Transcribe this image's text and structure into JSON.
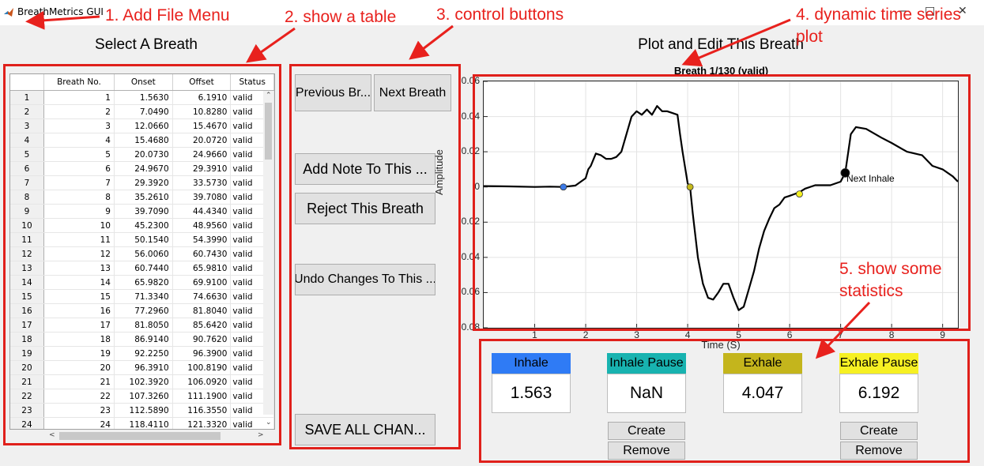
{
  "window": {
    "title": "BreathMetrics GUI",
    "minimize": "—",
    "maximize": "□",
    "close": "✕"
  },
  "annotations": {
    "a1": "1. Add File Menu",
    "a2": "2. show a table",
    "a3": "3. control buttons",
    "a4_line1": "4. dynamic time series",
    "a4_line2": "plot",
    "a5_line1": "5. show some",
    "a5_line2": "statistics"
  },
  "left_panel": {
    "title": "Select A Breath"
  },
  "table": {
    "columns": [
      "Breath No.",
      "Onset",
      "Offset",
      "Status"
    ],
    "rows": [
      [
        "1",
        "1",
        "1.5630",
        "6.1910",
        "valid"
      ],
      [
        "2",
        "2",
        "7.0490",
        "10.8280",
        "valid"
      ],
      [
        "3",
        "3",
        "12.0660",
        "15.4670",
        "valid"
      ],
      [
        "4",
        "4",
        "15.4680",
        "20.0720",
        "valid"
      ],
      [
        "5",
        "5",
        "20.0730",
        "24.9660",
        "valid"
      ],
      [
        "6",
        "6",
        "24.9670",
        "29.3910",
        "valid"
      ],
      [
        "7",
        "7",
        "29.3920",
        "33.5730",
        "valid"
      ],
      [
        "8",
        "8",
        "35.2610",
        "39.7080",
        "valid"
      ],
      [
        "9",
        "9",
        "39.7090",
        "44.4340",
        "valid"
      ],
      [
        "10",
        "10",
        "45.2300",
        "48.9560",
        "valid"
      ],
      [
        "11",
        "11",
        "50.1540",
        "54.3990",
        "valid"
      ],
      [
        "12",
        "12",
        "56.0060",
        "60.7430",
        "valid"
      ],
      [
        "13",
        "13",
        "60.7440",
        "65.9810",
        "valid"
      ],
      [
        "14",
        "14",
        "65.9820",
        "69.9100",
        "valid"
      ],
      [
        "15",
        "15",
        "71.3340",
        "74.6630",
        "valid"
      ],
      [
        "16",
        "16",
        "77.2960",
        "81.8040",
        "valid"
      ],
      [
        "17",
        "17",
        "81.8050",
        "85.6420",
        "valid"
      ],
      [
        "18",
        "18",
        "86.9140",
        "90.7620",
        "valid"
      ],
      [
        "19",
        "19",
        "92.2250",
        "96.3900",
        "valid"
      ],
      [
        "20",
        "20",
        "96.3910",
        "100.8190",
        "valid"
      ],
      [
        "21",
        "21",
        "102.3920",
        "106.0920",
        "valid"
      ],
      [
        "22",
        "22",
        "107.3260",
        "111.1900",
        "valid"
      ],
      [
        "23",
        "23",
        "112.5890",
        "116.3550",
        "valid"
      ],
      [
        "24",
        "24",
        "118.4110",
        "121.3320",
        "valid"
      ]
    ]
  },
  "controls": {
    "prev": "Previous Br...",
    "next": "Next Breath",
    "add_note": "Add Note To This ...",
    "reject": "Reject This Breath",
    "undo": "Undo Changes To This ...",
    "save": "SAVE ALL CHAN..."
  },
  "plot_panel": {
    "title": "Plot and Edit This Breath"
  },
  "plot": {
    "title": "Breath 1/130 (valid)",
    "xlabel": "Time (S)",
    "ylabel": "Amplitude",
    "next_inhale_label": "Next Inhale",
    "x_ticks": [
      "1",
      "2",
      "3",
      "4",
      "5",
      "6",
      "7",
      "8",
      "9"
    ],
    "y_ticks": [
      "0.06",
      "0.04",
      "0.02",
      "0",
      "-0.02",
      "-0.04",
      "-0.06",
      "-0.08"
    ]
  },
  "chart_data": {
    "type": "line",
    "title": "Breath 1/130 (valid)",
    "xlabel": "Time (S)",
    "ylabel": "Amplitude",
    "xlim": [
      0.0,
      9.3
    ],
    "ylim": [
      -0.08,
      0.06
    ],
    "grid": true,
    "series": [
      {
        "x": [
          0.0,
          0.5,
          1.0,
          1.3,
          1.563,
          1.8,
          2.0,
          2.05,
          2.1,
          2.2,
          2.3,
          2.4,
          2.5,
          2.6,
          2.7,
          2.8,
          2.9,
          3.0,
          3.1,
          3.2,
          3.3,
          3.4,
          3.5,
          3.6,
          3.7,
          3.8,
          3.85,
          3.9,
          4.0,
          4.047,
          4.1,
          4.2,
          4.3,
          4.4,
          4.5,
          4.6,
          4.7,
          4.8,
          4.9,
          5.0,
          5.1,
          5.2,
          5.3,
          5.4,
          5.5,
          5.6,
          5.7,
          5.8,
          5.9,
          6.0,
          6.1,
          6.192,
          6.3,
          6.5,
          6.8,
          7.0,
          7.09,
          7.15,
          7.2,
          7.3,
          7.5,
          7.8,
          8.0,
          8.3,
          8.6,
          8.8,
          9.0,
          9.2,
          9.3
        ],
        "y": [
          0.0005,
          0.0003,
          0.0,
          0.0002,
          0.0,
          0.0008,
          0.005,
          0.01,
          0.012,
          0.019,
          0.018,
          0.016,
          0.016,
          0.017,
          0.02,
          0.03,
          0.04,
          0.043,
          0.041,
          0.044,
          0.041,
          0.046,
          0.043,
          0.043,
          0.042,
          0.041,
          0.03,
          0.02,
          0.002,
          0.0,
          -0.015,
          -0.04,
          -0.055,
          -0.063,
          -0.064,
          -0.06,
          -0.055,
          -0.055,
          -0.063,
          -0.07,
          -0.068,
          -0.058,
          -0.048,
          -0.035,
          -0.025,
          -0.018,
          -0.012,
          -0.01,
          -0.006,
          -0.005,
          -0.004,
          -0.003,
          -0.001,
          0.001,
          0.001,
          0.003,
          0.008,
          0.02,
          0.03,
          0.034,
          0.033,
          0.028,
          0.025,
          0.02,
          0.018,
          0.012,
          0.01,
          0.006,
          0.003
        ]
      }
    ],
    "markers": [
      {
        "x": 1.563,
        "y": 0.0,
        "color": "#3d7be8"
      },
      {
        "x": 4.047,
        "y": 0.0,
        "color": "#c4b81c"
      },
      {
        "x": 6.192,
        "y": -0.004,
        "color": "#f3f020"
      },
      {
        "x": 7.09,
        "y": 0.008,
        "color": "#000000"
      }
    ]
  },
  "stats": {
    "inhale": {
      "label": "Inhale",
      "value": "1.563",
      "color": "#2f7bf5"
    },
    "inhale_pause": {
      "label": "Inhale Pause",
      "value": "NaN",
      "color": "#18b3b0"
    },
    "exhale": {
      "label": "Exhale",
      "value": "4.047",
      "color": "#c4b51c"
    },
    "exhale_pause": {
      "label": "Exhale Pause",
      "value": "6.192",
      "color": "#f6f023"
    },
    "create": "Create",
    "remove": "Remove"
  }
}
